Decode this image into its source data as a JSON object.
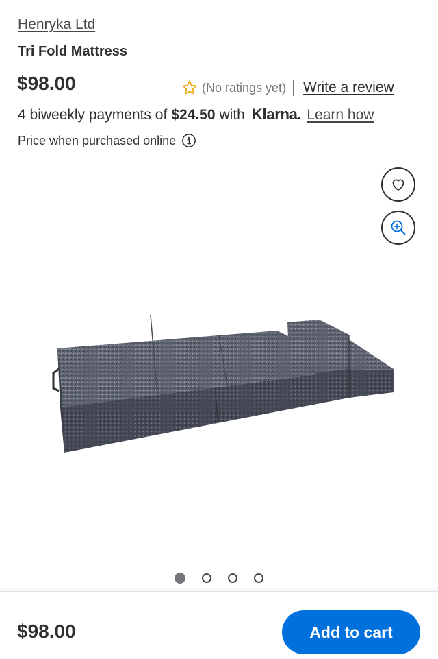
{
  "product": {
    "seller": "Henryka Ltd",
    "title": "Tri Fold Mattress",
    "price": "$98.00",
    "rating_text": "(No ratings yet)",
    "write_review": "Write a review",
    "price_note": "Price when purchased online"
  },
  "klarna": {
    "prefix": "4 biweekly payments of",
    "amount": "$24.50",
    "with": "with",
    "logo": "Klarna.",
    "learn": "Learn how"
  },
  "icons": {
    "star": "star-outline-icon",
    "info": "info-icon",
    "favorite": "heart-icon",
    "zoom": "zoom-in-icon"
  },
  "carousel": {
    "count": 4,
    "active": 1
  },
  "footer": {
    "price": "$98.00",
    "add_to_cart": "Add to cart"
  },
  "colors": {
    "accent": "#0071dc",
    "star": "#e8a200",
    "text": "#2e2f32"
  }
}
